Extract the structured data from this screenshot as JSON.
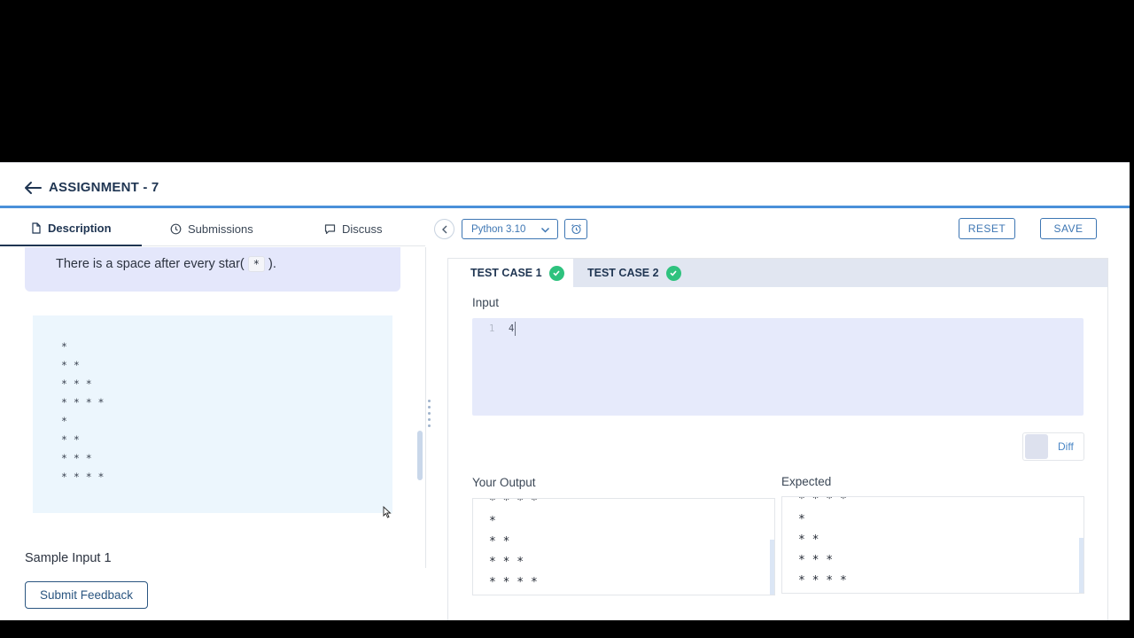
{
  "header": {
    "title": "ASSIGNMENT - 7"
  },
  "tabs": [
    {
      "label": "Description",
      "icon": "document-icon"
    },
    {
      "label": "Submissions",
      "icon": "clock-icon"
    },
    {
      "label": "Discuss",
      "icon": "chat-icon"
    }
  ],
  "description": {
    "note_prefix": "There is a space after every star(",
    "note_code": "*",
    "note_suffix": ").",
    "pattern_lines": [
      "*",
      "* *",
      "* * *",
      "* * * *",
      "*",
      "* *",
      "* * *",
      "* * * *"
    ],
    "sample_input_label": "Sample Input 1"
  },
  "feedback_button": "Submit Feedback",
  "toolbar": {
    "language": "Python 3.10",
    "reset_label": "RESET",
    "save_label": "SAVE"
  },
  "testcases": [
    {
      "label": "TEST CASE 1",
      "status": "passed"
    },
    {
      "label": "TEST CASE 2",
      "status": "passed"
    }
  ],
  "input": {
    "label": "Input",
    "line_number": "1",
    "value": "4"
  },
  "diff": {
    "label": "Diff"
  },
  "your_output": {
    "label": "Your Output",
    "lines": [
      "* * * *",
      "*",
      "* *",
      "* * *",
      "* * * *"
    ]
  },
  "expected": {
    "label": "Expected",
    "lines": [
      "* * * *",
      "*",
      "* *",
      "* * *",
      "* * * *"
    ]
  },
  "colors": {
    "accent": "#3d76b3",
    "success": "#2ec27e",
    "title": "#1f3552"
  }
}
